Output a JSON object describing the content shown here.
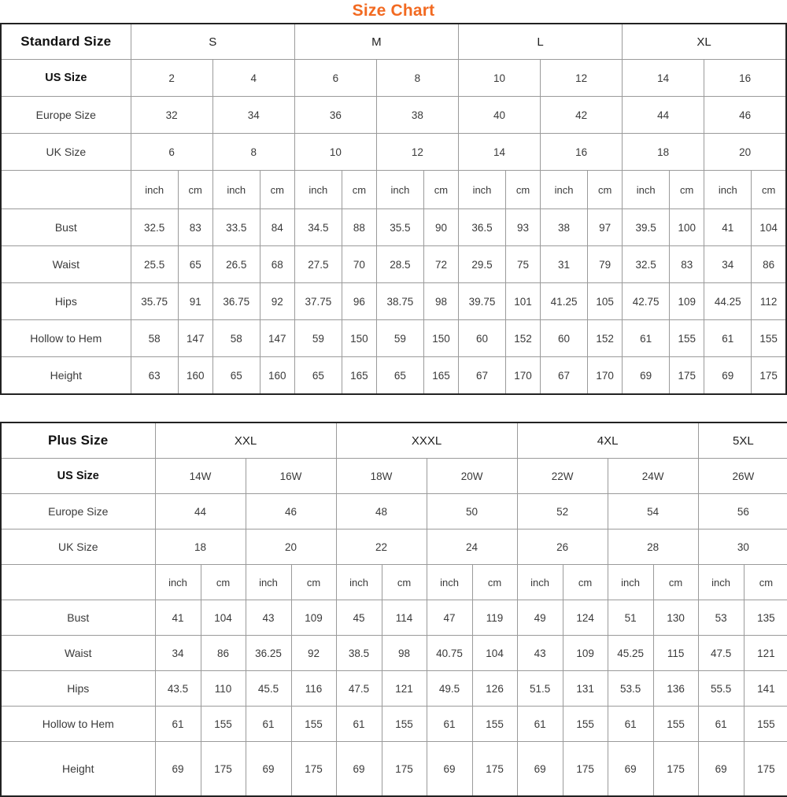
{
  "title": "Size Chart",
  "colors": {
    "title": "#F26A21",
    "outer_border": "#222222",
    "inner_border": "#9a9a9a",
    "text": "#3a3a3a",
    "background": "#ffffff"
  },
  "standard_table": {
    "corner_label": "Standard Size",
    "size_groups": [
      {
        "label": "S",
        "span": 2
      },
      {
        "label": "M",
        "span": 2
      },
      {
        "label": "L",
        "span": 2
      },
      {
        "label": "XL",
        "span": 2
      }
    ],
    "row_labels": {
      "us": "US Size",
      "europe": "Europe Size",
      "uk": "UK Size",
      "units": "",
      "bust": "Bust",
      "waist": "Waist",
      "hips": "Hips",
      "hollow": "Hollow to Hem",
      "height": "Height"
    },
    "us_size": [
      "2",
      "4",
      "6",
      "8",
      "10",
      "12",
      "14",
      "16"
    ],
    "europe_size": [
      "32",
      "34",
      "36",
      "38",
      "40",
      "42",
      "44",
      "46"
    ],
    "uk_size": [
      "6",
      "8",
      "10",
      "12",
      "14",
      "16",
      "18",
      "20"
    ],
    "unit_inch": "inch",
    "unit_cm": "cm",
    "measurements": [
      {
        "label": "Bust",
        "inch": [
          "32.5",
          "33.5",
          "34.5",
          "35.5",
          "36.5",
          "38",
          "39.5",
          "41"
        ],
        "cm": [
          "83",
          "84",
          "88",
          "90",
          "93",
          "97",
          "100",
          "104"
        ]
      },
      {
        "label": "Waist",
        "inch": [
          "25.5",
          "26.5",
          "27.5",
          "28.5",
          "29.5",
          "31",
          "32.5",
          "34"
        ],
        "cm": [
          "65",
          "68",
          "70",
          "72",
          "75",
          "79",
          "83",
          "86"
        ]
      },
      {
        "label": "Hips",
        "inch": [
          "35.75",
          "36.75",
          "37.75",
          "38.75",
          "39.75",
          "41.25",
          "42.75",
          "44.25"
        ],
        "cm": [
          "91",
          "92",
          "96",
          "98",
          "101",
          "105",
          "109",
          "112"
        ]
      },
      {
        "label": "Hollow to Hem",
        "inch": [
          "58",
          "58",
          "59",
          "59",
          "60",
          "60",
          "61",
          "61"
        ],
        "cm": [
          "147",
          "147",
          "150",
          "150",
          "152",
          "152",
          "155",
          "155"
        ]
      },
      {
        "label": "Height",
        "inch": [
          "63",
          "65",
          "65",
          "65",
          "67",
          "67",
          "69",
          "69"
        ],
        "cm": [
          "160",
          "160",
          "165",
          "165",
          "170",
          "170",
          "175",
          "175"
        ]
      }
    ]
  },
  "plus_table": {
    "corner_label": "Plus Size",
    "size_groups": [
      {
        "label": "XXL",
        "span": 2
      },
      {
        "label": "XXXL",
        "span": 2
      },
      {
        "label": "4XL",
        "span": 2
      },
      {
        "label": "5XL",
        "span": 1
      }
    ],
    "row_labels": {
      "us": "US Size",
      "europe": "Europe Size",
      "uk": "UK Size",
      "units": "",
      "bust": "Bust",
      "waist": "Waist",
      "hips": "Hips",
      "hollow": "Hollow to Hem",
      "height": "Height"
    },
    "us_size": [
      "14W",
      "16W",
      "18W",
      "20W",
      "22W",
      "24W",
      "26W"
    ],
    "europe_size": [
      "44",
      "46",
      "48",
      "50",
      "52",
      "54",
      "56"
    ],
    "uk_size": [
      "18",
      "20",
      "22",
      "24",
      "26",
      "28",
      "30"
    ],
    "unit_inch": "inch",
    "unit_cm": "cm",
    "measurements": [
      {
        "label": "Bust",
        "inch": [
          "41",
          "43",
          "45",
          "47",
          "49",
          "51",
          "53"
        ],
        "cm": [
          "104",
          "109",
          "114",
          "119",
          "124",
          "130",
          "135"
        ]
      },
      {
        "label": "Waist",
        "inch": [
          "34",
          "36.25",
          "38.5",
          "40.75",
          "43",
          "45.25",
          "47.5"
        ],
        "cm": [
          "86",
          "92",
          "98",
          "104",
          "109",
          "115",
          "121"
        ]
      },
      {
        "label": "Hips",
        "inch": [
          "43.5",
          "45.5",
          "47.5",
          "49.5",
          "51.5",
          "53.5",
          "55.5"
        ],
        "cm": [
          "110",
          "116",
          "121",
          "126",
          "131",
          "136",
          "141"
        ]
      },
      {
        "label": "Hollow to Hem",
        "inch": [
          "61",
          "61",
          "61",
          "61",
          "61",
          "61",
          "61"
        ],
        "cm": [
          "155",
          "155",
          "155",
          "155",
          "155",
          "155",
          "155"
        ]
      },
      {
        "label": "Height",
        "inch": [
          "69",
          "69",
          "69",
          "69",
          "69",
          "69",
          "69"
        ],
        "cm": [
          "175",
          "175",
          "175",
          "175",
          "175",
          "175",
          "175"
        ]
      }
    ]
  }
}
